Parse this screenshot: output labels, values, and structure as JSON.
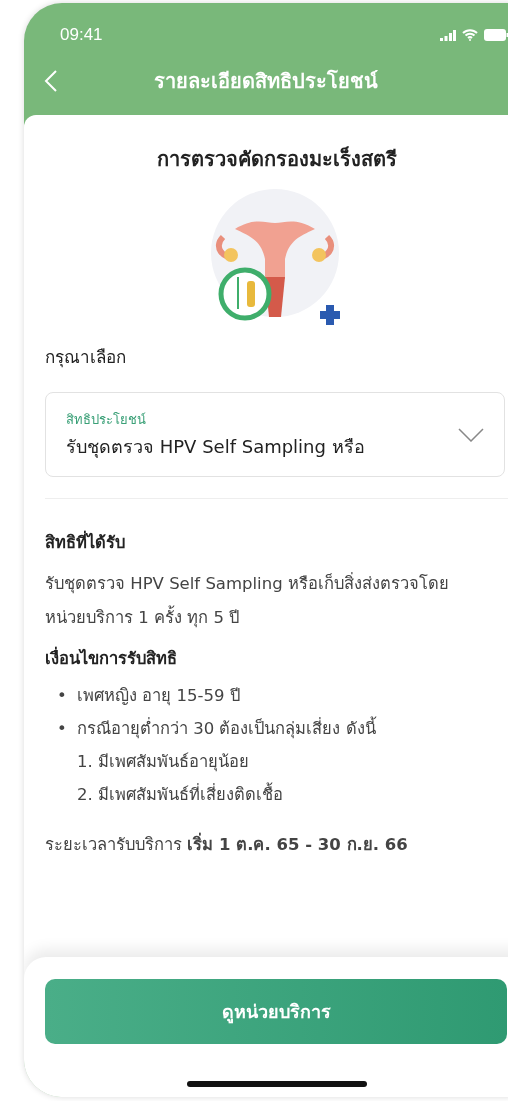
{
  "status_bar": {
    "time": "09:41"
  },
  "header": {
    "title": "รายละเอียดสิทธิประโยชน์"
  },
  "benefit_title": "การตรวจคัดกรองมะเร็งสตรี",
  "selection": {
    "prompt": "กรุณาเลือก",
    "label": "สิทธิประโยชน์",
    "value": "รับชุดตรวจ HPV Self Sampling หรือ"
  },
  "entitlement": {
    "heading": "สิทธิที่ได้รับ",
    "text": "รับชุดตรวจ HPV Self Sampling หรือเก็บสิ่งส่งตรวจโดยหน่วยบริการ 1 ครั้ง ทุก 5 ปี"
  },
  "conditions": {
    "heading": "เงื่อนไขการรับสิทธิ",
    "items": [
      {
        "kind": "bullet",
        "marker": "•",
        "text": "เพศหญิง อายุ 15-59 ปี"
      },
      {
        "kind": "bullet",
        "marker": "•",
        "text": "กรณีอายุต่ำกว่า 30 ต้องเป็นกลุ่มเสี่ยง ดังนี้"
      },
      {
        "kind": "numbered",
        "text": "1. มีเพศสัมพันธ์อายุน้อย"
      },
      {
        "kind": "numbered",
        "text": "2. มีเพศสัมพันธ์ที่เสี่ยงติดเชื้อ"
      }
    ]
  },
  "service_period": "ระยะเวลารับบริการ **เริ่ม 1 ต.ค. 65 - 30 ก.ย. 66**",
  "action_button": "ดูหน่วยบริการ"
}
